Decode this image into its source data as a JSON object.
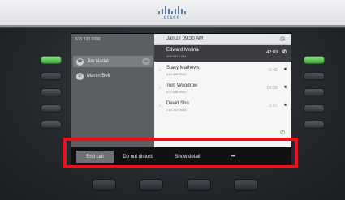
{
  "brand": {
    "name": "cisco"
  },
  "phone": {
    "extension": "515 333 0000",
    "lines": [
      {
        "label": "Jim Nadal",
        "icon": "phone-icon",
        "active": true,
        "badge": "⇨"
      },
      {
        "label": "Martin Bell",
        "icon": "handset-icon",
        "active": false,
        "badge": ""
      }
    ]
  },
  "header": {
    "datetime": "Jan 27  09:30 AM",
    "icon": "clock-icon"
  },
  "calls": [
    {
      "name": "Edward Molina",
      "number": "408 555 1234",
      "timer": "42:03",
      "state": "✆",
      "active": true
    },
    {
      "name": "Stacy Mathews",
      "number": "415 888 2345",
      "timer": "0:45",
      "state": "⏸",
      "active": false
    },
    {
      "name": "Tom Woodrow",
      "number": "672 658 2004",
      "timer": "10:28",
      "state": "⏸",
      "active": false
    },
    {
      "name": "David Shu",
      "number": "214 767 3435",
      "timer": "2:07",
      "state": "⏸",
      "active": false
    }
  ],
  "softkeys": [
    {
      "label": "End call",
      "selected": true
    },
    {
      "label": "Do not disturb",
      "selected": false
    },
    {
      "label": "Show detail",
      "selected": false
    },
    {
      "label": "•••",
      "selected": false
    }
  ],
  "colors": {
    "highlight": "#e8121a",
    "line_green": "#5cc457"
  }
}
